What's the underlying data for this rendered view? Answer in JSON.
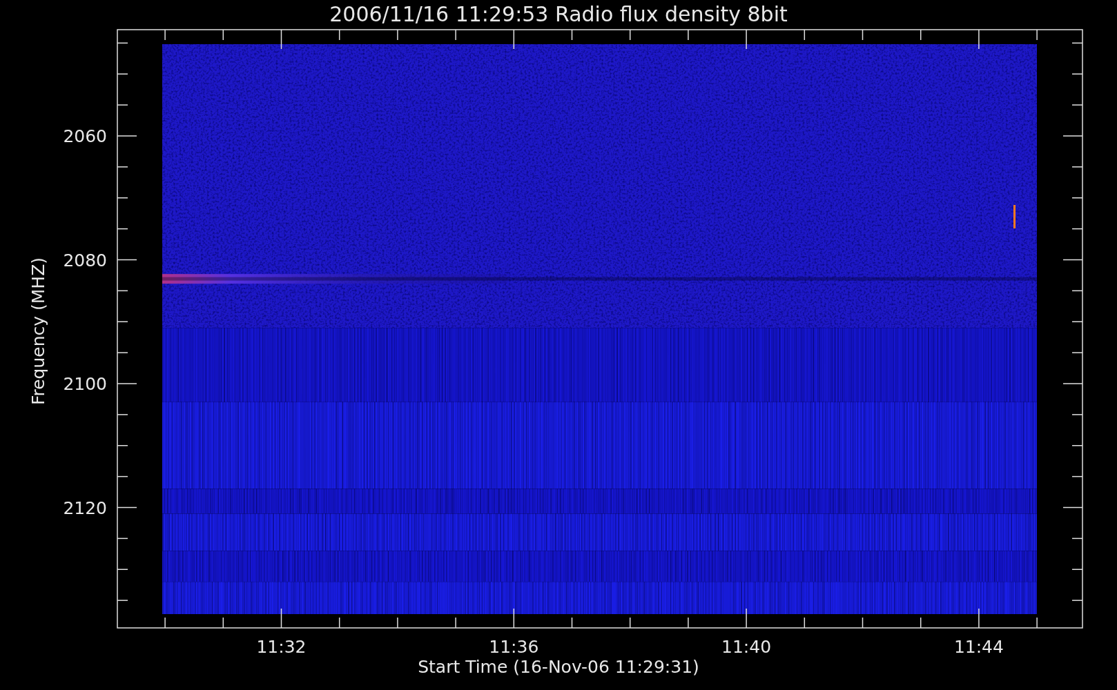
{
  "title": "2006/11/16 11:29:53 Radio flux density 8bit",
  "x_axis": {
    "label": "Start Time (16-Nov-06 11:29:31)",
    "ticks": [
      "11:32",
      "11:36",
      "11:40",
      "11:44"
    ]
  },
  "y_axis": {
    "label": "Frequency (MHZ)",
    "ticks": [
      "2060",
      "2080",
      "2100",
      "2120"
    ]
  }
}
